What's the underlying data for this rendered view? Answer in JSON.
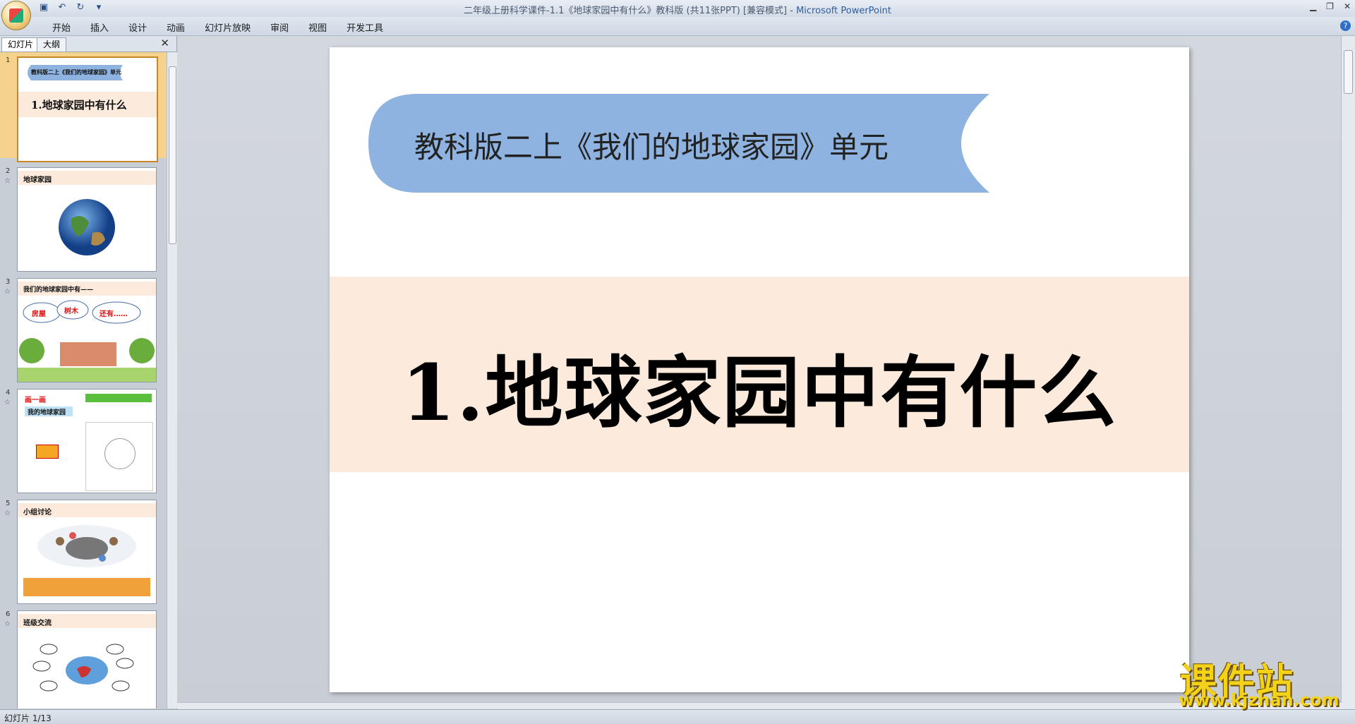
{
  "window": {
    "title_doc": "二年级上册科学课件-1.1《地球家园中有什么》教科版 (共11张PPT) [兼容模式] - ",
    "title_app": "Microsoft PowerPoint"
  },
  "menu": {
    "tabs": [
      "开始",
      "插入",
      "设计",
      "动画",
      "幻灯片放映",
      "审阅",
      "视图",
      "开发工具"
    ]
  },
  "panel": {
    "tab_slides": "幻灯片",
    "tab_outline": "大纲"
  },
  "thumbnails": [
    {
      "num": "1",
      "line1": "教科版二上《我们的地球家园》单元",
      "line2": "1.地球家园中有什么"
    },
    {
      "num": "2",
      "line1": "地球家园"
    },
    {
      "num": "3",
      "line1": "我们的地球家园中有——",
      "bubbles": [
        "房屋",
        "树木",
        "还有……"
      ]
    },
    {
      "num": "4",
      "line1": "画一画",
      "line2": "我的地球家园"
    },
    {
      "num": "5",
      "line1": "小组讨论"
    },
    {
      "num": "6",
      "line1": "班级交流"
    }
  ],
  "slide": {
    "banner_text": "教科版二上《我们的地球家园》单元",
    "title": "1.地球家园中有什么"
  },
  "status": {
    "slide_indicator": "幻灯片 1/13"
  },
  "watermark": {
    "text": "课件站",
    "url": "www.kjzhan.com"
  },
  "colors": {
    "banner_blue": "#8fb3e0",
    "title_band": "#fcebdc",
    "selected_thumb": "#f6d38d"
  }
}
